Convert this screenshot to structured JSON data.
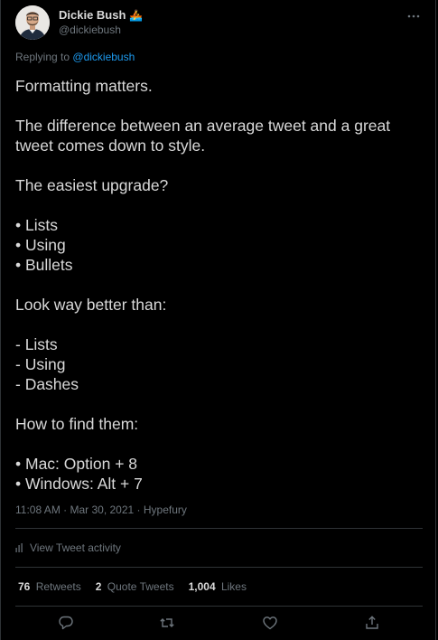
{
  "user": {
    "display_name": "Dickie Bush",
    "name_emoji": "🚣",
    "handle": "@dickiebush"
  },
  "reply": {
    "prefix": "Replying to",
    "target": "@dickiebush"
  },
  "tweet": {
    "lines": [
      "Formatting matters.",
      "",
      "The difference between an average tweet and a great",
      "tweet comes down to style.",
      "",
      "The easiest upgrade?",
      "",
      "• Lists",
      "• Using",
      "• Bullets",
      "",
      "Look way better than:",
      "",
      "- Lists",
      "- Using",
      "- Dashes",
      "",
      "How to find them:",
      "",
      "• Mac: Option + 8",
      "• Windows: Alt + 7"
    ],
    "timestamp": "11:08 AM · Mar 30, 2021 · Hypefury"
  },
  "activity_label": "View Tweet activity",
  "stats": {
    "retweets_count": "76",
    "retweets_label": "Retweets",
    "quotes_count": "2",
    "quotes_label": "Quote Tweets",
    "likes_count": "1,004",
    "likes_label": "Likes"
  },
  "colors": {
    "background": "#000000",
    "text": "#d9d9d9",
    "muted": "#6e767d",
    "link": "#1d9bf0",
    "divider": "#2f3336"
  }
}
